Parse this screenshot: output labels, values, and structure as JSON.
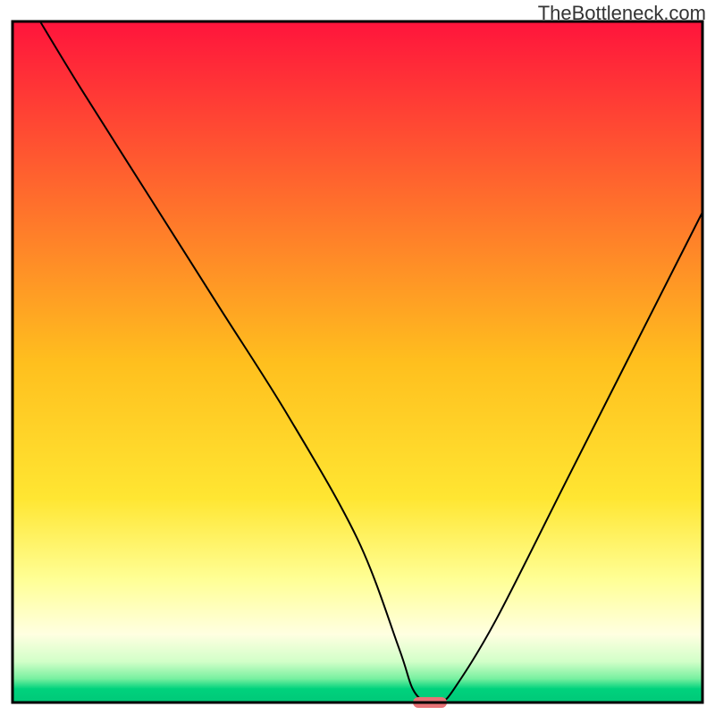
{
  "watermark": "TheBottleneck.com",
  "chart_data": {
    "type": "line",
    "title": "",
    "xlabel": "",
    "ylabel": "",
    "xlim": [
      0,
      100
    ],
    "ylim": [
      0,
      100
    ],
    "x": [
      4,
      10,
      20,
      30,
      40,
      50,
      56,
      58,
      60,
      62,
      64,
      70,
      80,
      90,
      100
    ],
    "y": [
      100,
      90,
      74,
      58,
      42,
      24,
      8,
      2,
      0,
      0,
      2,
      12,
      32,
      52,
      72
    ],
    "curve_description": "V-shaped bottleneck curve with minimum around x≈60; left branch descends from top-left, right branch rises toward upper-right",
    "marker": {
      "x": 60.5,
      "y": 0,
      "color": "#E77276",
      "shape": "rounded-rect"
    },
    "background_gradient": {
      "stops": [
        {
          "offset": 0.0,
          "color": "#FF143C"
        },
        {
          "offset": 0.5,
          "color": "#FFBF1E"
        },
        {
          "offset": 0.7,
          "color": "#FFE632"
        },
        {
          "offset": 0.82,
          "color": "#FFFF96"
        },
        {
          "offset": 0.9,
          "color": "#FFFFE1"
        },
        {
          "offset": 0.94,
          "color": "#D2FFC8"
        },
        {
          "offset": 0.965,
          "color": "#78F0A0"
        },
        {
          "offset": 0.98,
          "color": "#00D27D"
        },
        {
          "offset": 1.0,
          "color": "#00C878"
        }
      ]
    },
    "plot_border": "#000000",
    "curve_color": "#000000"
  }
}
